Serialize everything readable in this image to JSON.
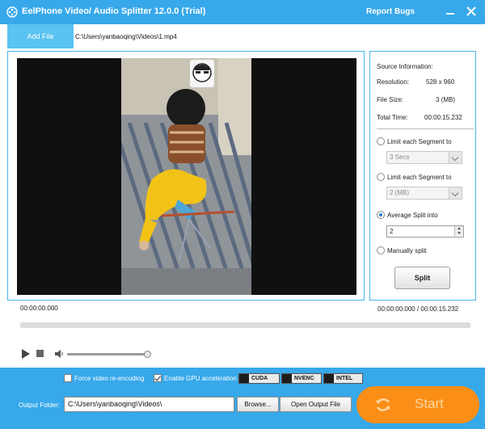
{
  "titlebar": {
    "title": "EelPhone Video/ Audio Splitter 12.0.0 (Trial)",
    "report_label": "Report Bugs",
    "minimize_icon": "minimize-icon",
    "close_icon": "close-icon"
  },
  "file": {
    "add_label": "Add File",
    "path": "C:\\Users\\yanbaoqing\\Videos\\1.mp4"
  },
  "source_info": {
    "title": "Source Information:",
    "resolution_label": "Resolution:",
    "resolution_value": "528 x 960",
    "filesize_label": "File Size:",
    "filesize_value": "3 (MB)",
    "totaltime_label": "Total Time:",
    "totaltime_value": "00:00:15.232"
  },
  "split_options": {
    "opt1_label": "Limit each Segment to",
    "opt1_value": "3 Secs",
    "opt2_label": "Limit each Segment to",
    "opt2_value": "2 (MB)",
    "opt3_label": "Average Split into",
    "opt3_value": "2",
    "opt4_label": "Manually split",
    "selected": "Average Split into",
    "split_label": "Split"
  },
  "player": {
    "current_time": "00:00:00.000",
    "time_readout": "00:00:00.000 / 00:00:15.232",
    "volume_level": 1.0
  },
  "bottom": {
    "force_reencode_label": "Force video re-encoding",
    "gpu_label": "Enable GPU acceleration",
    "gpu_cuda": "CUDA",
    "gpu_nvenc": "NVENC",
    "gpu_intel": "INTEL",
    "output_label": "Output Folder:",
    "output_path": "C:\\Users\\yanbaoqing\\Videos\\",
    "browse_label": "Browse...",
    "open_label": "Open Output File",
    "start_label": "Start"
  },
  "colors": {
    "accent": "#37a8ea",
    "add_button": "#59c3f1",
    "start_button": "#fb8e17"
  }
}
